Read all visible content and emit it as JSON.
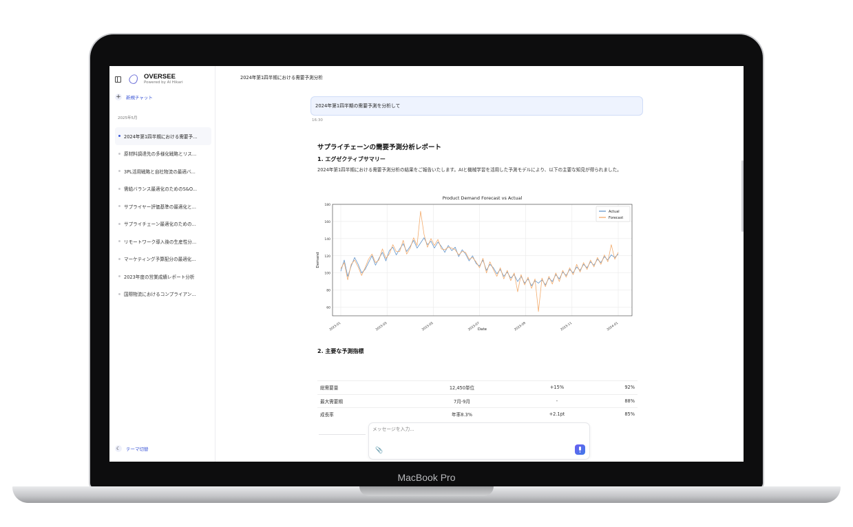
{
  "device": {
    "label": "MacBook Pro"
  },
  "sidebar": {
    "brand": {
      "name": "OVERSEE",
      "tagline": "Powered by AI Hikari"
    },
    "new_chat_label": "新規チャット",
    "month_label": "2025年5月",
    "items": [
      {
        "label": "2024年第1四半期における需要予...",
        "active": true
      },
      {
        "label": "原材料調達先の多様化戦略とリス...",
        "active": false
      },
      {
        "label": "3PL活用戦略と自社物流の最適バ...",
        "active": false
      },
      {
        "label": "需給バランス最適化のためのS&O...",
        "active": false
      },
      {
        "label": "サプライヤー評価基準の最適化と...",
        "active": false
      },
      {
        "label": "サプライチェーン最適化のための...",
        "active": false
      },
      {
        "label": "リモートワーク導入後の生産性分...",
        "active": false
      },
      {
        "label": "マーケティング予算配分の最適化...",
        "active": false
      },
      {
        "label": "2023年度の営業成績レポート分析",
        "active": false
      },
      {
        "label": "国際物流におけるコンプライアン...",
        "active": false
      }
    ],
    "theme_toggle_label": "テーマ切替"
  },
  "main": {
    "title": "2024年第1四半期における需要予測分析",
    "user_message": {
      "text": "2024年第1四半期の需要予測を分析して",
      "time": "16:30"
    },
    "report": {
      "title": "サプライチェーンの需要予測分析レポート",
      "section1_heading": "1. エグゼクティブサマリー",
      "section1_text": "2024年第1四半期における需要予測分析の結果をご報告いたします。AIと機械学習を活用した予測モデルにより、以下の主要な知見が得られました。",
      "section2_heading": "2. 主要な予測指標",
      "table_rows": [
        [
          "総需要量",
          "12,450単位",
          "+15%",
          "92%"
        ],
        [
          "最大需要期",
          "7月-9月",
          "-",
          "88%"
        ],
        [
          "成長率",
          "年率8.3%",
          "+2.1pt",
          "85%"
        ]
      ]
    },
    "composer": {
      "placeholder": "メッセージを入力..."
    }
  },
  "chart_data": {
    "type": "line",
    "title": "Product Demand Forecast vs Actual",
    "xlabel": "Date",
    "ylabel": "Demand",
    "ylim": [
      50,
      180
    ],
    "x_ticks": [
      "2023-01",
      "2023-03",
      "2023-05",
      "2023-07",
      "2023-09",
      "2023-11",
      "2024-01"
    ],
    "y_ticks": [
      60,
      80,
      100,
      120,
      140,
      160,
      180
    ],
    "grid": true,
    "legend": "top-right",
    "x_start": "2023-01-01",
    "x_end": "2024-01-01",
    "series": [
      {
        "name": "Actual",
        "color": "#5a8fc8",
        "values": [
          102,
          115,
          96,
          108,
          118,
          110,
          100,
          104,
          112,
          120,
          109,
          117,
          124,
          114,
          126,
          130,
          121,
          128,
          134,
          125,
          131,
          138,
          129,
          135,
          141,
          133,
          137,
          129,
          136,
          131,
          124,
          132,
          126,
          130,
          119,
          127,
          122,
          114,
          120,
          111,
          108,
          115,
          103,
          110,
          106,
          99,
          104,
          96,
          101,
          94,
          98,
          90,
          96,
          88,
          93,
          85,
          91,
          88,
          92,
          86,
          94,
          90,
          98,
          93,
          101,
          97,
          104,
          100,
          107,
          103,
          110,
          106,
          113,
          109,
          116,
          112,
          119,
          115,
          121,
          118,
          122
        ]
      },
      {
        "name": "Forecast",
        "color": "#f2a25c",
        "values": [
          105,
          112,
          92,
          110,
          115,
          107,
          97,
          106,
          116,
          122,
          112,
          115,
          128,
          117,
          122,
          133,
          125,
          125,
          138,
          122,
          129,
          141,
          132,
          172,
          145,
          130,
          140,
          132,
          139,
          128,
          127,
          130,
          129,
          127,
          121,
          125,
          124,
          116,
          118,
          113,
          106,
          117,
          100,
          113,
          104,
          96,
          106,
          93,
          103,
          91,
          100,
          78,
          98,
          86,
          95,
          82,
          93,
          55,
          94,
          84,
          96,
          87,
          100,
          90,
          103,
          95,
          106,
          98,
          110,
          101,
          112,
          104,
          115,
          107,
          118,
          110,
          121,
          113,
          133,
          116,
          124
        ]
      }
    ]
  }
}
